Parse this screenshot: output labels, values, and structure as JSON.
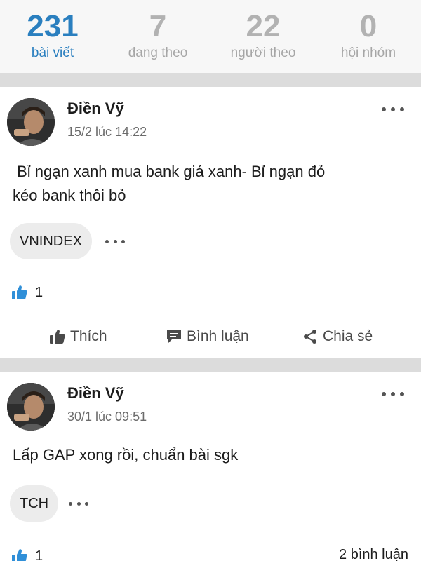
{
  "stats": [
    {
      "value": "231",
      "label": "bài viết",
      "active": true
    },
    {
      "value": "7",
      "label": "đang theo",
      "active": false
    },
    {
      "value": "22",
      "label": "người theo",
      "active": false
    },
    {
      "value": "0",
      "label": "hội nhóm",
      "active": false
    }
  ],
  "posts": [
    {
      "author": "Điền Vỹ",
      "date": "15/2 lúc 14:22",
      "content_line1": " Bỉ ngạn xanh mua bank giá xanh- Bỉ ngạn đỏ",
      "content_line2": "kéo bank thôi bỏ",
      "tag": "VNINDEX",
      "likes": "1"
    },
    {
      "author": "Điền Vỹ",
      "date": "30/1 lúc 09:51",
      "content_line1": "Lấp GAP xong rồi, chuẩn bài sgk",
      "tag": "TCH",
      "likes": "1",
      "comments": "2 bình luận"
    }
  ],
  "actions": {
    "like": "Thích",
    "comment": "Bình luận",
    "share": "Chia sẻ"
  },
  "colors": {
    "accent": "#2a7fbf",
    "like_icon": "#2f8fd8",
    "separator": "#dcdcdc"
  },
  "icons": [
    "avatar",
    "more-dots-icon",
    "thumbs-up-icon",
    "comment-icon",
    "share-icon"
  ]
}
